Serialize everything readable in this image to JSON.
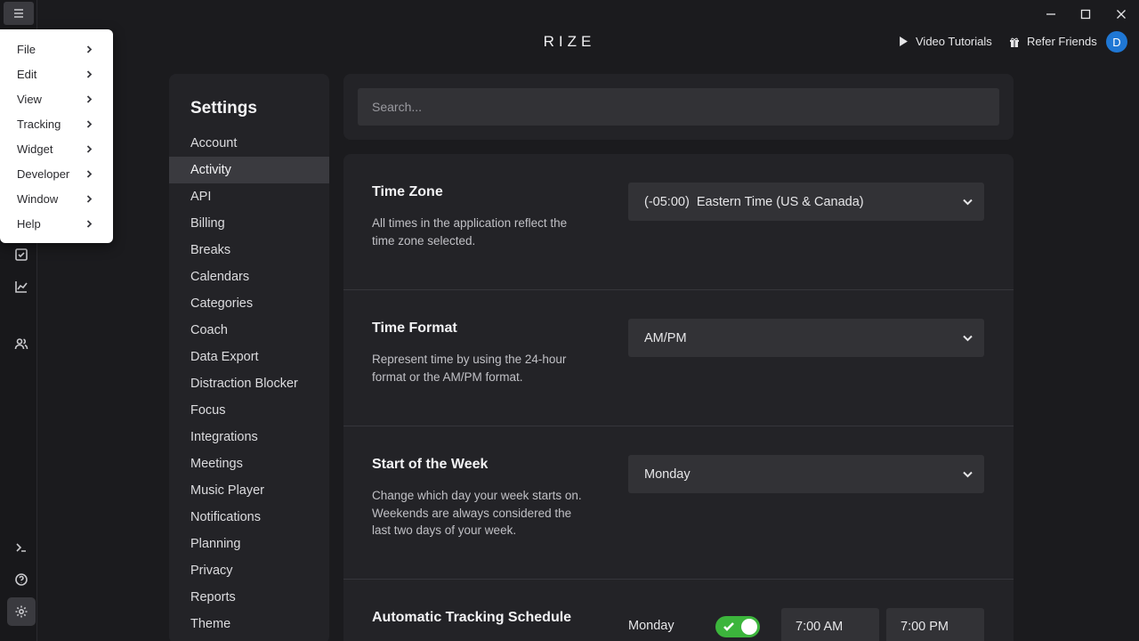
{
  "app": {
    "brand": "RIZE"
  },
  "header": {
    "video_tutorials": "Video Tutorials",
    "refer_friends": "Refer Friends",
    "avatar_initial": "D"
  },
  "menu": {
    "items": [
      {
        "label": "File"
      },
      {
        "label": "Edit"
      },
      {
        "label": "View"
      },
      {
        "label": "Tracking"
      },
      {
        "label": "Widget"
      },
      {
        "label": "Developer"
      },
      {
        "label": "Window"
      },
      {
        "label": "Help"
      }
    ]
  },
  "settings": {
    "title": "Settings",
    "active_item": "Activity",
    "items": [
      "Account",
      "Activity",
      "API",
      "Billing",
      "Breaks",
      "Calendars",
      "Categories",
      "Coach",
      "Data Export",
      "Distraction Blocker",
      "Focus",
      "Integrations",
      "Meetings",
      "Music Player",
      "Notifications",
      "Planning",
      "Privacy",
      "Reports",
      "Theme"
    ]
  },
  "search": {
    "placeholder": "Search..."
  },
  "sections": {
    "timezone": {
      "title": "Time Zone",
      "desc": "All times in the application reflect the time zone selected.",
      "value": "(-05:00)  Eastern Time (US & Canada)"
    },
    "timeformat": {
      "title": "Time Format",
      "desc": "Represent time by using the 24-hour format or the AM/PM format.",
      "value": "AM/PM"
    },
    "weekstart": {
      "title": "Start of the Week",
      "desc": "Change which day your week starts on. Weekends are always considered the last two days of your week.",
      "value": "Monday"
    },
    "schedule": {
      "title": "Automatic Tracking Schedule",
      "day": "Monday",
      "enabled": true,
      "start": "7:00 AM",
      "end": "7:00 PM"
    }
  },
  "colors": {
    "accent_green": "#3cb53c",
    "avatar_blue": "#1f77d4"
  }
}
